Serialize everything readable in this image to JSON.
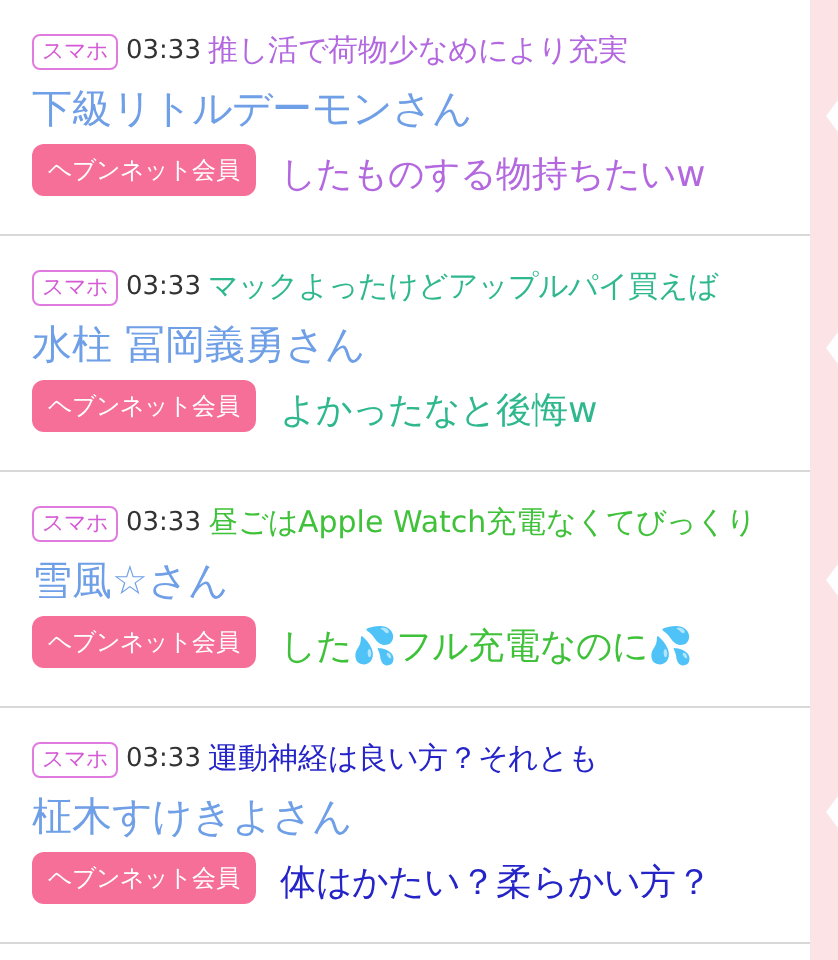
{
  "posts": [
    {
      "device": "スマホ",
      "time": "03:33",
      "name": "下級リトルデーモンさん",
      "member_badge": "ヘブンネット会員",
      "caption": {
        "color": "#b368e0",
        "lines": [
          "推し活で荷物少なめにより充実",
          "したものする物持ちたいw"
        ]
      }
    },
    {
      "device": "スマホ",
      "time": "03:33",
      "name": "水柱 冨岡義勇さん",
      "member_badge": "ヘブンネット会員",
      "caption": {
        "color": "#2fb88e",
        "lines": [
          "マックよったけどアップルパイ買えば",
          "よかったなと後悔w"
        ]
      }
    },
    {
      "device": "スマホ",
      "time": "03:33",
      "name": "雪風☆さん",
      "member_badge": "ヘブンネット会員",
      "caption": {
        "color": "#3fc23a",
        "lines": [
          "昼ごはApple Watch充電なくてびっくり",
          "した💦フル充電なのに💦"
        ]
      }
    },
    {
      "device": "スマホ",
      "time": "03:33",
      "name": "柾木すけきよさん",
      "member_badge": "ヘブンネット会員",
      "caption": {
        "color": "#2424c8",
        "lines": [
          "運動神経は良い方？それとも",
          "体はかたい？柔らかい方？"
        ]
      }
    }
  ]
}
